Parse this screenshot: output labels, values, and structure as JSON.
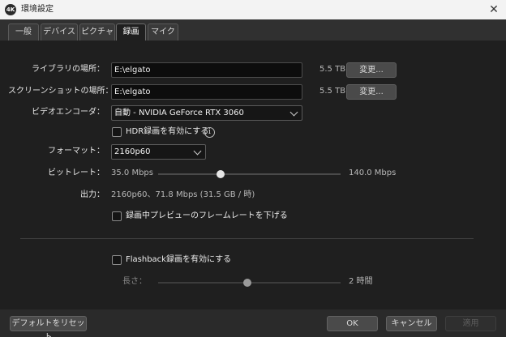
{
  "window": {
    "app_icon_text": "4K",
    "title": "環境設定",
    "close_glyph": "✕"
  },
  "tabs": [
    {
      "label": "一般",
      "active": false
    },
    {
      "label": "デバイス",
      "active": false
    },
    {
      "label": "ピクチャ",
      "active": false
    },
    {
      "label": "録画",
      "active": true
    },
    {
      "label": "マイク",
      "active": false
    }
  ],
  "recording": {
    "library_label": "ライブラリの場所：",
    "library_path": "E:\\elgato",
    "library_size": "5.5 TB",
    "library_change": "変更...",
    "screenshot_label": "スクリーンショットの場所：",
    "screenshot_path": "E:\\elgato",
    "screenshot_size": "5.5 TB",
    "screenshot_change": "変更...",
    "encoder_label": "ビデオエンコーダ：",
    "encoder_value": "自動 - NVIDIA GeForce RTX 3060",
    "hdr_label": "HDR録画を有効にする",
    "hdr_checked": false,
    "info_glyph": "i",
    "format_label": "フォーマット：",
    "format_value": "2160p60",
    "bitrate_label": "ビットレート：",
    "bitrate_min": "35.0 Mbps",
    "bitrate_max": "140.0 Mbps",
    "bitrate_fraction": 0.34,
    "output_label": "出力：",
    "output_value": "2160p60、71.8 Mbps (31.5 GB / 時)",
    "preview_label": "録画中プレビューのフレームレートを下げる",
    "preview_checked": false,
    "flashback_label": "Flashback録画を有効にする",
    "flashback_checked": false,
    "length_label": "長さ：",
    "length_value": "2 時間",
    "length_fraction": 0.49
  },
  "footer": {
    "reset_label": "デフォルトをリセット",
    "ok_label": "OK",
    "cancel_label": "キャンセル",
    "apply_label": "適用"
  }
}
